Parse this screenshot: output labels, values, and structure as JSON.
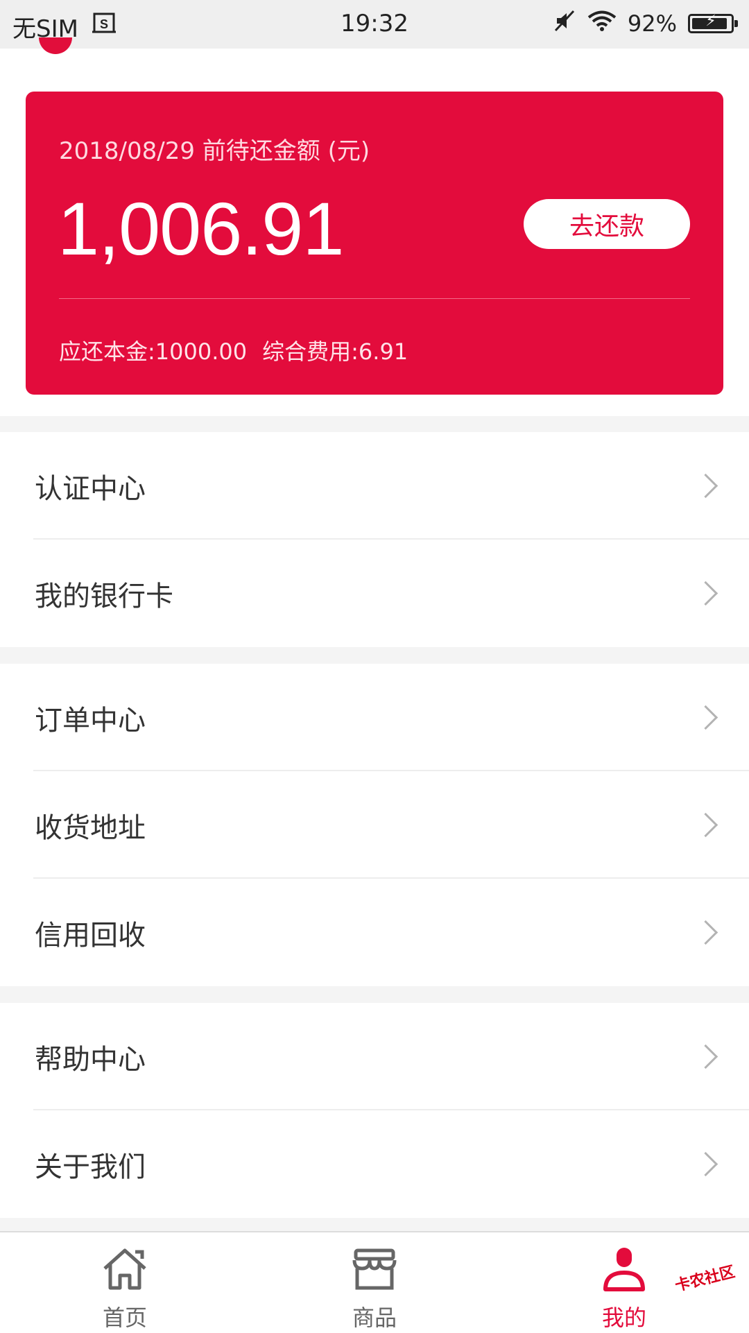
{
  "status_bar": {
    "sim": "无SIM",
    "time": "19:32",
    "battery": "92%",
    "battery_level": 0.92
  },
  "card": {
    "date_label": "2018/08/29 前待还金额 (元)",
    "amount": "1,006.91",
    "repay_button": "去还款",
    "principal": "应还本金:1000.00",
    "fees": "综合费用:6.91",
    "color": "#e30c3c"
  },
  "menu_groups": [
    [
      "认证中心",
      "我的银行卡"
    ],
    [
      "订单中心",
      "收货地址",
      "信用回收"
    ],
    [
      "帮助中心",
      "关于我们"
    ]
  ],
  "bottom_nav": {
    "items": [
      {
        "label": "首页",
        "icon": "home-icon",
        "active": false
      },
      {
        "label": "商品",
        "icon": "store-icon",
        "active": false
      },
      {
        "label": "我的",
        "icon": "profile-icon",
        "active": true
      }
    ]
  },
  "watermark": "卡农社区"
}
